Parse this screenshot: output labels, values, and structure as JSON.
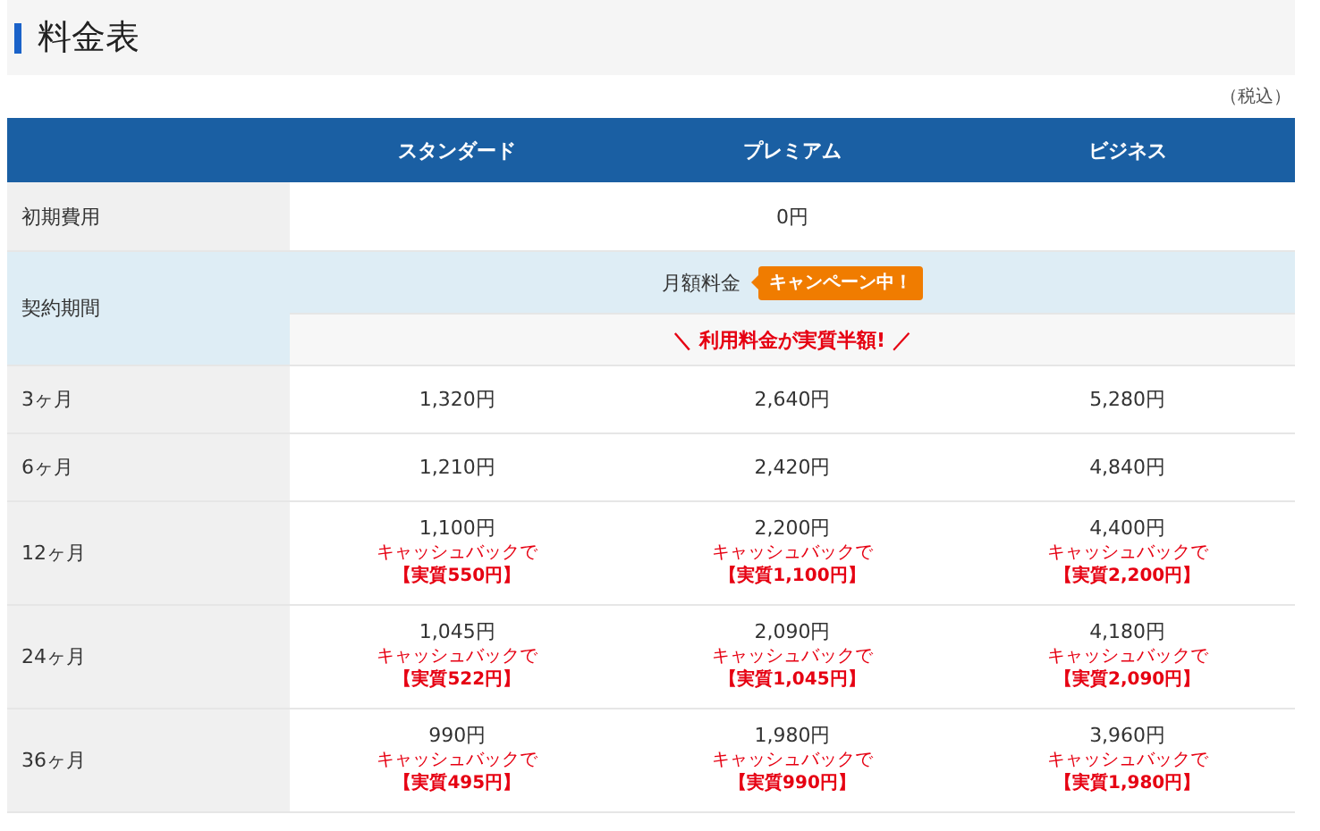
{
  "title": "料金表",
  "tax_note": "（税込）",
  "table": {
    "columns": [
      "スタンダード",
      "プレミアム",
      "ビジネス"
    ],
    "initial_fee": {
      "label": "初期費用",
      "value": "0円"
    },
    "contract": {
      "label": "契約期間",
      "monthly_label": "月額料金",
      "campaign_badge": "キャンペーン中！",
      "promo": "＼ 利用料金が実質半額! ／"
    },
    "rows": [
      {
        "label": "3ヶ月",
        "cells": [
          {
            "price": "1,320円"
          },
          {
            "price": "2,640円"
          },
          {
            "price": "5,280円"
          }
        ]
      },
      {
        "label": "6ヶ月",
        "cells": [
          {
            "price": "1,210円"
          },
          {
            "price": "2,420円"
          },
          {
            "price": "4,840円"
          }
        ]
      },
      {
        "label": "12ヶ月",
        "cells": [
          {
            "price": "1,100円",
            "cashback_note": "キャッシュバックで",
            "effective": "【実質550円】"
          },
          {
            "price": "2,200円",
            "cashback_note": "キャッシュバックで",
            "effective": "【実質1,100円】"
          },
          {
            "price": "4,400円",
            "cashback_note": "キャッシュバックで",
            "effective": "【実質2,200円】"
          }
        ]
      },
      {
        "label": "24ヶ月",
        "cells": [
          {
            "price": "1,045円",
            "cashback_note": "キャッシュバックで",
            "effective": "【実質522円】"
          },
          {
            "price": "2,090円",
            "cashback_note": "キャッシュバックで",
            "effective": "【実質1,045円】"
          },
          {
            "price": "4,180円",
            "cashback_note": "キャッシュバックで",
            "effective": "【実質2,090円】"
          }
        ]
      },
      {
        "label": "36ヶ月",
        "cells": [
          {
            "price": "990円",
            "cashback_note": "キャッシュバックで",
            "effective": "【実質495円】"
          },
          {
            "price": "1,980円",
            "cashback_note": "キャッシュバックで",
            "effective": "【実質990円】"
          },
          {
            "price": "3,960円",
            "cashback_note": "キャッシュバックで",
            "effective": "【実質1,980円】"
          }
        ]
      }
    ]
  }
}
